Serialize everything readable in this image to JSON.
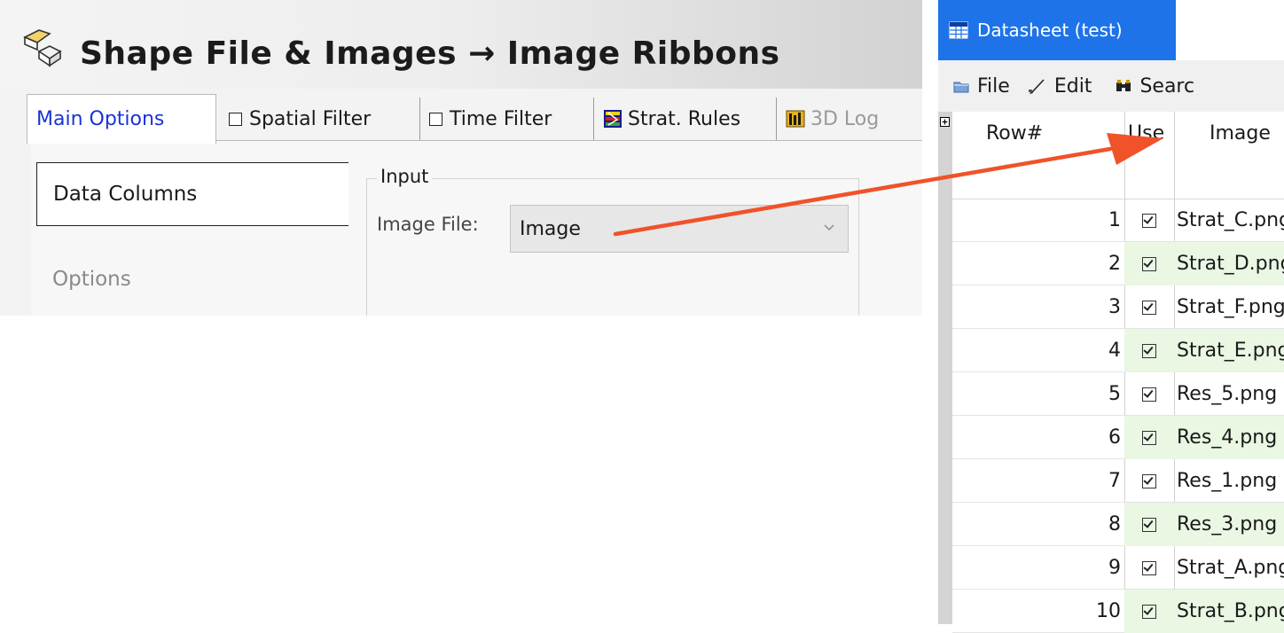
{
  "colors": {
    "accent_blue": "#1e73e8",
    "active_tab_text": "#1834d6",
    "arrow": "#f0522a",
    "row_alt_green": "#e9f7e3"
  },
  "dialog": {
    "title": "Shape File & Images → Image Ribbons",
    "title_icon": "shape-file-icon",
    "tabs": [
      {
        "label": "Main Options",
        "active": true
      },
      {
        "label": "Spatial Filter",
        "checkbox": true
      },
      {
        "label": "Time Filter",
        "checkbox": true
      },
      {
        "label": "Strat. Rules",
        "icon": "strat-rules-icon"
      },
      {
        "label": "3D Log ",
        "icon": "3d-log-icon"
      }
    ],
    "side_items": [
      {
        "label": "Data Columns",
        "selected": true
      },
      {
        "label": "Options",
        "selected": false
      }
    ],
    "input_group": {
      "legend": "Input",
      "image_file_label": "Image File:",
      "image_file_value": "Image"
    }
  },
  "datasheet": {
    "title": "Datasheet (test)",
    "title_icon": "datasheet-icon",
    "toolbar": [
      {
        "label": "File",
        "icon": "file-icon"
      },
      {
        "label": "Edit",
        "icon": "edit-icon"
      },
      {
        "label": "Searc",
        "icon": "binoculars-icon"
      }
    ],
    "columns": [
      "Row#",
      "Use",
      "Image"
    ],
    "rows": [
      {
        "num": "1",
        "use": true,
        "image": "Strat_C.png"
      },
      {
        "num": "2",
        "use": true,
        "image": "Strat_D.png"
      },
      {
        "num": "3",
        "use": true,
        "image": "Strat_F.png"
      },
      {
        "num": "4",
        "use": true,
        "image": "Strat_E.png"
      },
      {
        "num": "5",
        "use": true,
        "image": "Res_5.png"
      },
      {
        "num": "6",
        "use": true,
        "image": "Res_4.png"
      },
      {
        "num": "7",
        "use": true,
        "image": "Res_1.png"
      },
      {
        "num": "8",
        "use": true,
        "image": "Res_3.png"
      },
      {
        "num": "9",
        "use": true,
        "image": "Strat_A.png"
      },
      {
        "num": "10",
        "use": true,
        "image": "Strat_B.png"
      }
    ]
  }
}
